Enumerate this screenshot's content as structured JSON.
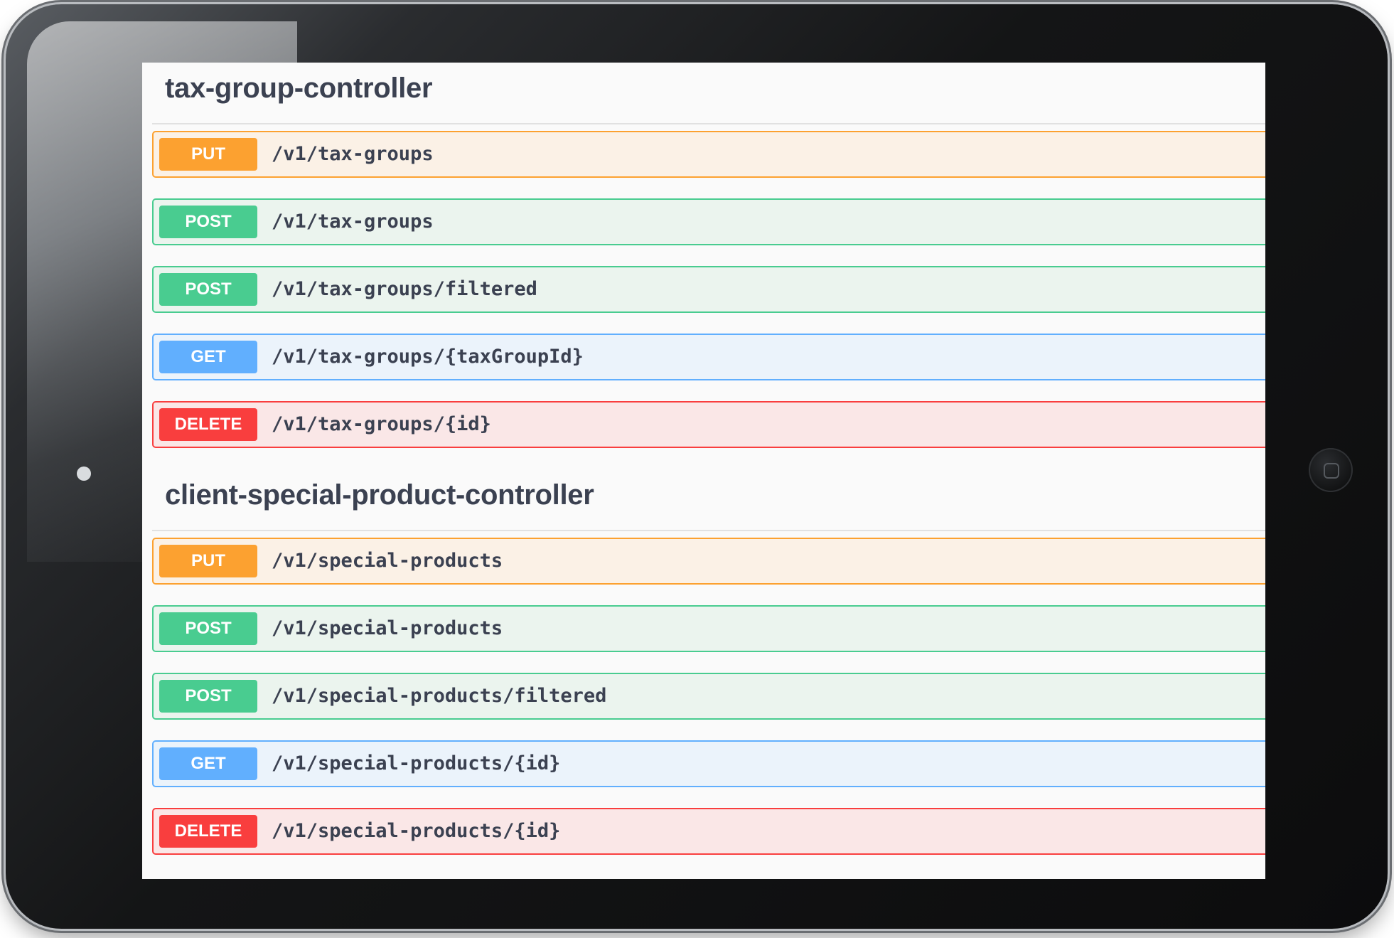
{
  "sections": [
    {
      "title": "tax-group-controller",
      "operations": [
        {
          "method": "PUT",
          "path": "/v1/tax-groups"
        },
        {
          "method": "POST",
          "path": "/v1/tax-groups"
        },
        {
          "method": "POST",
          "path": "/v1/tax-groups/filtered"
        },
        {
          "method": "GET",
          "path": "/v1/tax-groups/{taxGroupId}"
        },
        {
          "method": "DELETE",
          "path": "/v1/tax-groups/{id}"
        }
      ]
    },
    {
      "title": "client-special-product-controller",
      "operations": [
        {
          "method": "PUT",
          "path": "/v1/special-products"
        },
        {
          "method": "POST",
          "path": "/v1/special-products"
        },
        {
          "method": "POST",
          "path": "/v1/special-products/filtered"
        },
        {
          "method": "GET",
          "path": "/v1/special-products/{id}"
        },
        {
          "method": "DELETE",
          "path": "/v1/special-products/{id}"
        }
      ]
    }
  ],
  "colors": {
    "put": "#fca130",
    "post": "#49cc90",
    "get": "#61affe",
    "delete": "#f93e3e",
    "text": "#3b4151"
  },
  "icons": {
    "camera": "camera-dot-icon",
    "home": "home-button-icon"
  }
}
